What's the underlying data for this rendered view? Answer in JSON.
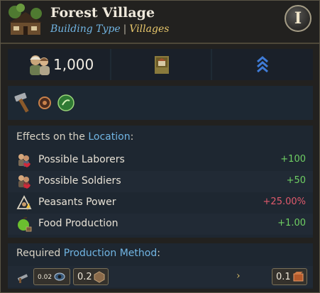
{
  "header": {
    "title": "Forest Village",
    "subtitle_type": "Building Type",
    "subtitle_sep": "|",
    "subtitle_value": "Villages",
    "info_label": "I"
  },
  "stats": {
    "population": "1,000"
  },
  "effects": {
    "heading_prefix": "Effects on the ",
    "heading_highlight": "Location",
    "heading_suffix": ":",
    "rows": [
      {
        "label": "Possible Laborers",
        "value": "+100",
        "tone": "positive"
      },
      {
        "label": "Possible Soldiers",
        "value": "+50",
        "tone": "positive"
      },
      {
        "label": "Peasants Power",
        "value": "+25.00%",
        "tone": "negative"
      },
      {
        "label": "Food Production",
        "value": "+1.00",
        "tone": "positive"
      }
    ]
  },
  "required": {
    "heading_prefix": "Required ",
    "heading_highlight": "Production Method",
    "heading_suffix": ":",
    "input_small": "0.02",
    "input_main": "0.2",
    "output_value": "0.1",
    "arrow": "›"
  },
  "colors": {
    "accent_blue": "#71b5e3",
    "gold": "#e8c76b",
    "positive": "#6fcf63",
    "negative": "#e05a6c"
  }
}
